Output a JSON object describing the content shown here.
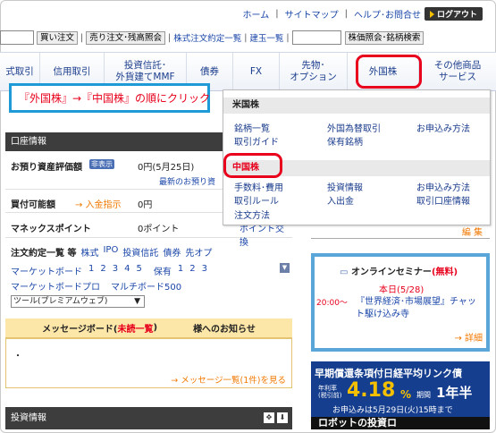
{
  "header": {
    "links": [
      "ホーム",
      "サイトマップ",
      "ヘルプ･お問合せ"
    ],
    "logout_label": "ログアウト"
  },
  "toolbar": {
    "buy_label": "買い注文",
    "sell_label": "売り注文･残高照会",
    "order_link": "株式注文約定一覧",
    "tatekyoku_link": "建玉一覧",
    "quote_label": "株価照会･銘柄検索"
  },
  "nav": {
    "items": [
      {
        "label": "式取引"
      },
      {
        "label": "信用取引"
      },
      {
        "label": "投資信託･\n外貨建てMMF"
      },
      {
        "label": "債券"
      },
      {
        "label": "FX"
      },
      {
        "label": "先物･\nオプション"
      },
      {
        "label": "外国株"
      },
      {
        "label": "その他商品\nサービス"
      }
    ]
  },
  "callout": {
    "text": "『外国株』→『中国株』の順にクリック"
  },
  "account": {
    "header": "口座情報",
    "asset_label": "お預り資産評価額",
    "hide_label": "非表示",
    "asset_value": "0円(5月25日)",
    "latest_link": "最新のお預り資",
    "buying_power_label": "買付可能額",
    "deposit_link": "→ 入金指示",
    "buying_power_value": "0円",
    "points_label": "マネックスポイント",
    "points_value": "0ポイント",
    "points_link": "ポイント交換",
    "orders_label": "注文約定一覧 等",
    "order_tabs": [
      "株式",
      "IPO",
      "投資信託",
      "債券",
      "先オプ"
    ],
    "board_label": "マーケットボード",
    "board_nums": [
      "1",
      "2",
      "3",
      "4",
      "5"
    ],
    "holding_label": "保有",
    "holding_nums": [
      "1",
      "2",
      "3"
    ],
    "board_pro": "マーケットボードプロ",
    "multi_board": "マルチボード500",
    "tool_select": "ツール(プレミアムウェブ)"
  },
  "message": {
    "title_prefix": "メッセージボード(",
    "unread": "未読一覧",
    "title_suffix": ")",
    "notice": "様へのお知らせ",
    "dot": "・",
    "more_link": "→ メッセージ一覧(1件)を見る"
  },
  "invest": {
    "header": "投資情報"
  },
  "dropdown": {
    "us_section": "米国株",
    "us_items": [
      "銘柄一覧",
      "外国為替取引",
      "お申込み方法",
      "取引ガイド",
      "保有銘柄"
    ],
    "cn_section": "中国株",
    "cn_items": [
      "手数料･費用",
      "投資情報",
      "お申込み方法",
      "取引ルール",
      "入出金",
      "取引口座情報",
      "注文方法"
    ]
  },
  "right": {
    "edit_link": "編 集",
    "seminar_title": "オンラインセミナー",
    "seminar_free": "(無料)",
    "seminar_date": "本日(5/28)",
    "seminar_time": "20:00～",
    "seminar_desc": "『世界経済･市場展望』チャット駆け込み寺",
    "detail_link": "→ 詳細"
  },
  "banner": {
    "title": "早期償還条項付日経平均リンク債",
    "rate_label": "年利率\n(税引前)",
    "rate": "4.18",
    "rate_unit": "%",
    "period_label": "期間",
    "period": "1年半",
    "deadline": "お申込みは5月29日(火)15時まで",
    "bottom": "ロボットの投資ロ"
  },
  "colors": {
    "highlight_red": "#e8001c",
    "callout_blue": "#1e9ad6",
    "nav_text": "#1a3c8c"
  }
}
